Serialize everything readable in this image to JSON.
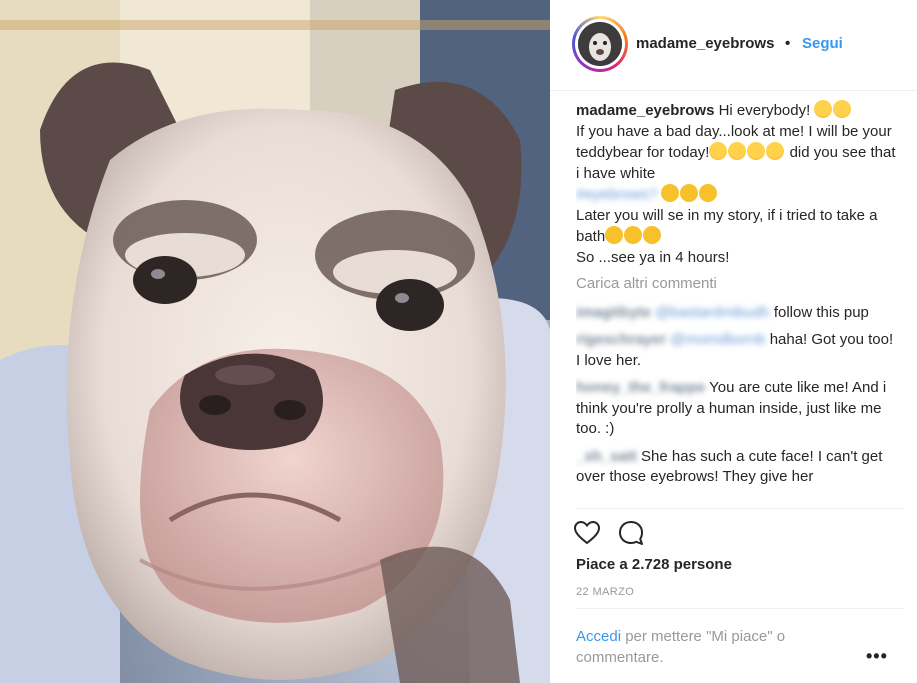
{
  "header": {
    "username": "madame_eyebrows",
    "dot": "•",
    "follow_label": "Segui"
  },
  "caption": {
    "username": "madame_eyebrows",
    "line1": "Hi everybody!",
    "line2": "If you have a bad day...look at me! I will be your teddybear for today!",
    "line2_end": "did you see that i have white",
    "hashtag": "#eyebrows?",
    "line3": "Later you will se in my story, if i tried to take a bath",
    "line4": "So ...see ya in 4 hours!"
  },
  "load_more": "Carica altri commenti",
  "comments": [
    {
      "user": "imagitbyte",
      "mention": "@bastardmibudh",
      "text": "follow this pup"
    },
    {
      "user": "rigeschrayer",
      "mention": "@momdbornb",
      "text": "haha! Got you too! I love her."
    },
    {
      "user": "honey_the_frappe",
      "mention": "",
      "text": "You are cute like me! And i think you're prolly a human inside, just like me too. :)"
    },
    {
      "user": "_xh_satt",
      "mention": "",
      "text": "She has such a cute face! I can't get over those eyebrows! They give her"
    }
  ],
  "likes_text": "Piace a 2.728 persone",
  "date_text": "22 MARZO",
  "login": {
    "link": "Accedi",
    "text": "per mettere \"Mi piace\" o commentare."
  },
  "more_label": "•••",
  "icons": {
    "like": "heart-icon",
    "comment": "comment-bubble-icon"
  },
  "colors": {
    "link_blue": "#3897f0",
    "muted": "#999999",
    "text": "#262626"
  }
}
